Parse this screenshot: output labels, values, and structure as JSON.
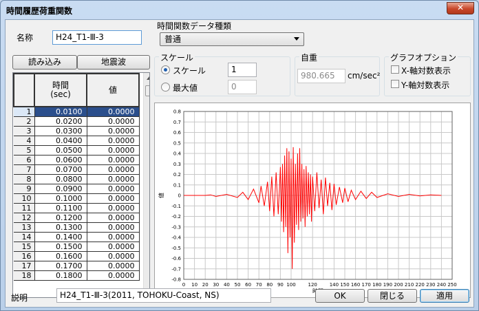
{
  "window": {
    "title": "時間履歴荷重関数",
    "close_glyph": "✕"
  },
  "name_field": {
    "label": "名称",
    "value": "H24_T1-Ⅲ-3"
  },
  "function_type": {
    "group_title": "時間関数データ種類",
    "selected": "普通"
  },
  "buttons": {
    "load": "読み込み",
    "earthquake": "地震波",
    "ok": "OK",
    "close": "閉じる",
    "apply": "適用"
  },
  "scale_group": {
    "title": "スケール",
    "scale_label": "スケール",
    "scale_value": "1",
    "scale_selected": true,
    "max_label": "最大値",
    "max_value": "0",
    "max_selected": false
  },
  "gravity_group": {
    "title": "自重",
    "value": "980.665",
    "unit": "cm/sec²"
  },
  "graph_options": {
    "title": "グラフオプション",
    "x_log": "X-軸対数表示",
    "y_log": "Y-軸対数表示",
    "x_log_checked": false,
    "y_log_checked": false
  },
  "table": {
    "col_time": "時間",
    "col_time_unit": "(sec)",
    "col_value": "値",
    "rows": [
      {
        "n": "1",
        "t": "0.0100",
        "v": "0.0000"
      },
      {
        "n": "2",
        "t": "0.0200",
        "v": "0.0000"
      },
      {
        "n": "3",
        "t": "0.0300",
        "v": "0.0000"
      },
      {
        "n": "4",
        "t": "0.0400",
        "v": "0.0000"
      },
      {
        "n": "5",
        "t": "0.0500",
        "v": "0.0000"
      },
      {
        "n": "6",
        "t": "0.0600",
        "v": "0.0000"
      },
      {
        "n": "7",
        "t": "0.0700",
        "v": "0.0000"
      },
      {
        "n": "8",
        "t": "0.0800",
        "v": "0.0000"
      },
      {
        "n": "9",
        "t": "0.0900",
        "v": "0.0000"
      },
      {
        "n": "10",
        "t": "0.1000",
        "v": "0.0000"
      },
      {
        "n": "11",
        "t": "0.1100",
        "v": "0.0000"
      },
      {
        "n": "12",
        "t": "0.1200",
        "v": "0.0000"
      },
      {
        "n": "13",
        "t": "0.1300",
        "v": "0.0000"
      },
      {
        "n": "14",
        "t": "0.1400",
        "v": "0.0000"
      },
      {
        "n": "15",
        "t": "0.1500",
        "v": "0.0000"
      },
      {
        "n": "16",
        "t": "0.1600",
        "v": "0.0000"
      },
      {
        "n": "17",
        "t": "0.1700",
        "v": "0.0000"
      },
      {
        "n": "18",
        "t": "0.1800",
        "v": "0.0000"
      }
    ]
  },
  "description": {
    "label": "説明",
    "value": "H24_T1-Ⅲ-3(2011, TOHOKU-Coast, NS)"
  },
  "chart_data": {
    "type": "line",
    "xlabel": "時間",
    "ylabel": "値",
    "xlim": [
      0,
      250
    ],
    "ylim": [
      -0.8,
      0.8
    ],
    "xticks": [
      0,
      10,
      20,
      30,
      40,
      50,
      60,
      70,
      80,
      90,
      100,
      110,
      120,
      130,
      140,
      150,
      160,
      170,
      180,
      190,
      200,
      210,
      220,
      230,
      240,
      250
    ],
    "xtick_labels": [
      "0",
      "10",
      "20",
      "30",
      "40",
      "50",
      "60",
      "70",
      "80",
      "90",
      "100",
      "",
      "120",
      "",
      "140",
      "150",
      "160",
      "170",
      "180",
      "190",
      "200",
      "210",
      "220",
      "230",
      "240",
      "250"
    ],
    "yticks": [
      0.8,
      0.7,
      0.6,
      0.5,
      0.4,
      0.3,
      0.2,
      0.1,
      0,
      -0.1,
      -0.2,
      -0.3,
      -0.4,
      -0.5,
      -0.6,
      -0.7,
      -0.8
    ],
    "grid": true,
    "line_color": "#ff0000",
    "series": [
      {
        "x": [
          0,
          10,
          20,
          25,
          30,
          40,
          50,
          55,
          60,
          65,
          70,
          72,
          75,
          78,
          80,
          82,
          84,
          86,
          88,
          90,
          91,
          92,
          93,
          94,
          95,
          96,
          97,
          98,
          99,
          100,
          101,
          102,
          103,
          104,
          105,
          106,
          107,
          108,
          109,
          110,
          111,
          112,
          113,
          114,
          115,
          116,
          117,
          118,
          119,
          120,
          122,
          124,
          126,
          128,
          130,
          132,
          134,
          136,
          138,
          140,
          142,
          145,
          148,
          150,
          153,
          156,
          160,
          165,
          170,
          175,
          180,
          190,
          200,
          210,
          220,
          230,
          240
        ],
        "y": [
          0,
          0,
          0,
          0.005,
          -0.01,
          0.01,
          -0.02,
          0.03,
          -0.04,
          0.06,
          -0.07,
          0.09,
          -0.1,
          0.13,
          -0.15,
          0.18,
          -0.2,
          0.22,
          -0.18,
          0.27,
          -0.25,
          0.3,
          -0.35,
          0.38,
          -0.3,
          0.45,
          -0.55,
          0.42,
          -0.4,
          0.35,
          -0.7,
          0.46,
          -0.45,
          0.3,
          -0.28,
          0.4,
          -0.33,
          0.45,
          -0.25,
          0.3,
          -0.22,
          0.25,
          -0.3,
          0.28,
          -0.2,
          0.22,
          -0.18,
          0.2,
          -0.25,
          0.18,
          -0.15,
          0.22,
          -0.12,
          0.15,
          -0.18,
          0.17,
          -0.1,
          0.12,
          -0.14,
          0.11,
          -0.09,
          0.08,
          -0.07,
          0.07,
          -0.06,
          0.05,
          -0.04,
          0.04,
          -0.03,
          0.03,
          -0.02,
          0.015,
          -0.01,
          0.01,
          -0.005,
          0.005,
          0
        ]
      }
    ]
  }
}
